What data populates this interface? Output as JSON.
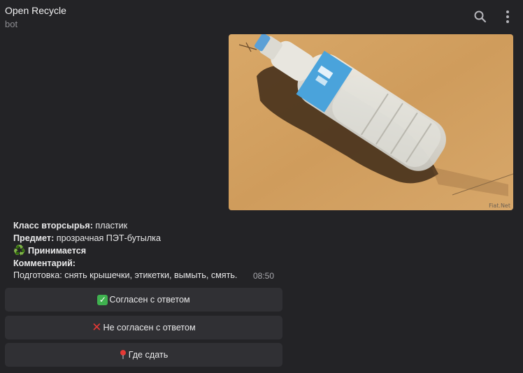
{
  "header": {
    "title": "Open Recycle",
    "subtitle": "bot"
  },
  "photo": {
    "watermark": "Fiat.Net"
  },
  "message": {
    "class_label": "Класс вторсырья:",
    "class_value": " пластик",
    "item_label": "Предмет:",
    "item_value": " прозрачная ПЭТ-бутылка",
    "status_icon": "♻️",
    "status_text": "Принимается",
    "comment_label": "Комментарий:",
    "prep_text": "Подготовка: снять крышечки, этикетки, вымыть, смять.",
    "time": "08:50"
  },
  "buttons": {
    "agree": "Согласен с ответом",
    "disagree": "Не согласен с ответом",
    "where": "Где сдать"
  },
  "colors": {
    "background": "#232326",
    "button_bg": "#303034",
    "accent_green": "#3fb14f",
    "accent_red": "#e53935"
  },
  "icons": {
    "search": "search-icon",
    "menu": "more-vert-icon",
    "check": "check-mark-icon",
    "cross": "cross-mark-icon",
    "pin": "pin-icon",
    "recycle": "recycle-icon"
  }
}
